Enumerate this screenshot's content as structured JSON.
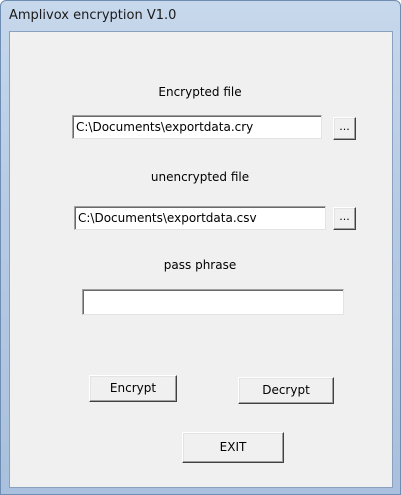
{
  "window": {
    "title": "Amplivox encryption V1.0"
  },
  "encrypted": {
    "label": "Encrypted file",
    "value": "C:\\Documents\\exportdata.cry",
    "browse_label": "..."
  },
  "unencrypted": {
    "label": "unencrypted file",
    "value": "C:\\Documents\\exportdata.csv",
    "browse_label": "..."
  },
  "pass": {
    "label": "pass phrase",
    "value": ""
  },
  "buttons": {
    "encrypt": "Encrypt",
    "decrypt": "Decrypt",
    "exit": "EXIT"
  }
}
